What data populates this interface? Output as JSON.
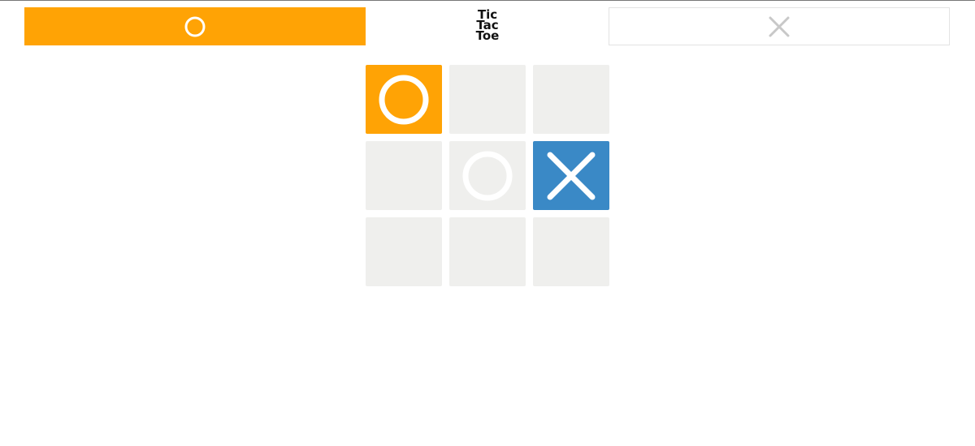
{
  "title": {
    "line1": "Tic",
    "line2": "Tac",
    "line3": "Toe"
  },
  "players": {
    "o": {
      "symbol": "O",
      "active": true
    },
    "x": {
      "symbol": "X",
      "active": false
    }
  },
  "colors": {
    "o_accent": "#FFA305",
    "x_accent": "#3A89C6",
    "empty_cell": "#EFEFED",
    "inactive_mark": "#C8C8C8"
  },
  "board": [
    [
      "O",
      "",
      ""
    ],
    [
      "",
      "O",
      "X"
    ],
    [
      "",
      "",
      ""
    ]
  ],
  "highlighted_cells": [
    {
      "row": 0,
      "col": 0,
      "mark": "O"
    },
    {
      "row": 1,
      "col": 2,
      "mark": "X"
    }
  ]
}
